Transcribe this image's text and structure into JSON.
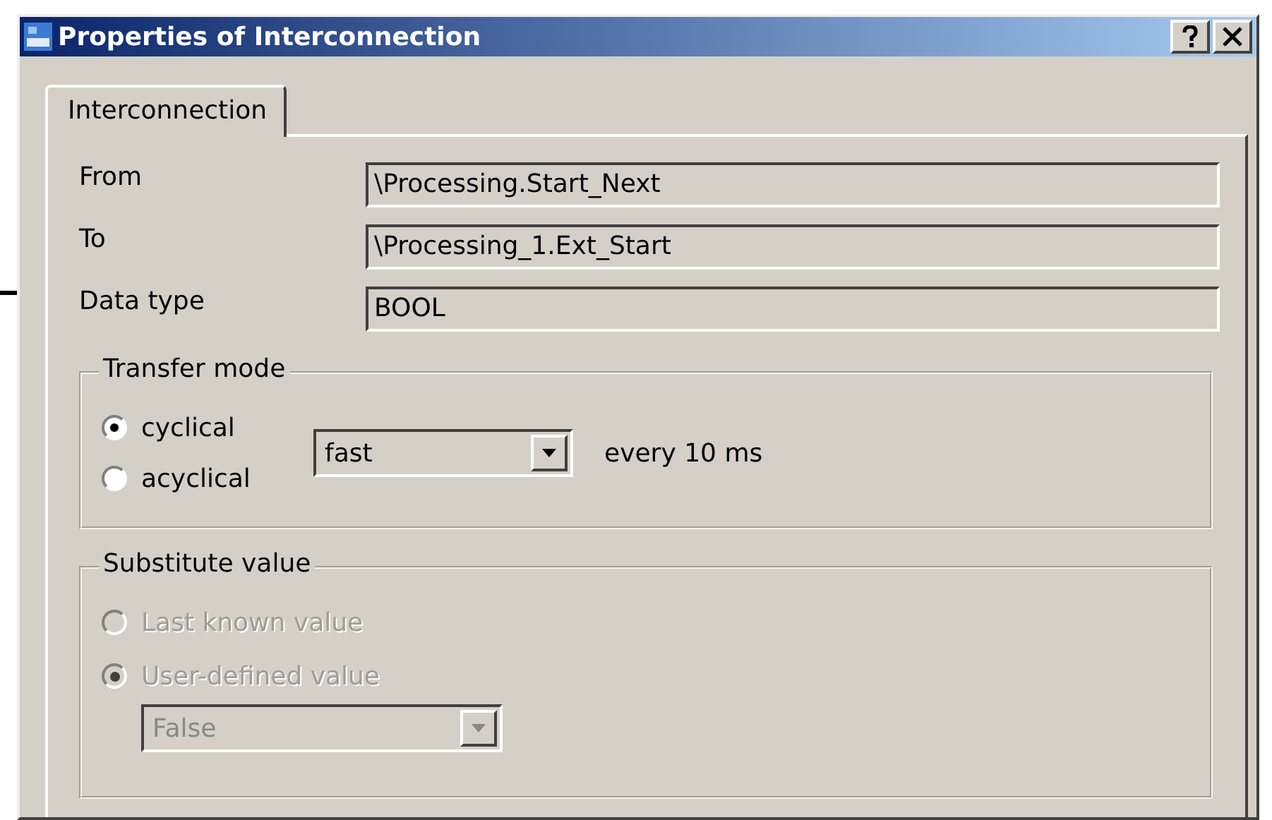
{
  "window": {
    "title": "Properties of Interconnection"
  },
  "tabs": [
    {
      "label": "Interconnection",
      "selected": true
    }
  ],
  "fields": [
    {
      "label": "From",
      "value": "\\Processing.Start_Next"
    },
    {
      "label": "To",
      "value": "\\Processing_1.Ext_Start"
    },
    {
      "label": "Data type",
      "value": "BOOL"
    }
  ],
  "transfer_mode": {
    "title": "Transfer mode",
    "options": [
      {
        "label": "cyclical",
        "selected": true
      },
      {
        "label": "acyclical",
        "selected": false
      }
    ],
    "dropdown": {
      "value": "fast",
      "disabled": false
    },
    "note": "every 10 ms"
  },
  "substitute_value": {
    "title": "Substitute value",
    "disabled": true,
    "options": [
      {
        "label": "Last known value",
        "selected": false
      },
      {
        "label": "User-defined value",
        "selected": true
      }
    ],
    "dropdown": {
      "value": "False",
      "disabled": true
    }
  }
}
